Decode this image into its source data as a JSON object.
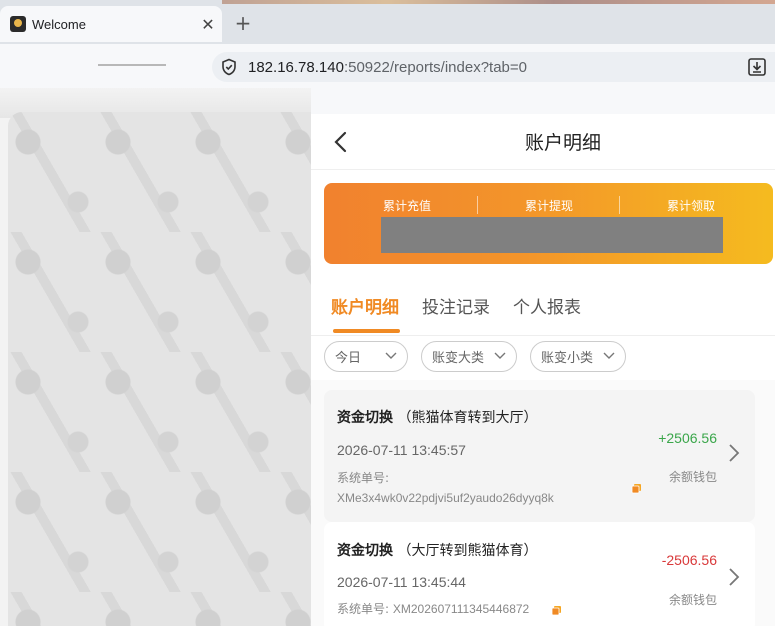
{
  "browser": {
    "tab_title": "Welcome",
    "close_glyph": "✕",
    "newtab_glyph": "+",
    "url_host": "182.16.78.140",
    "url_rest": ":50922/reports/index?tab=0"
  },
  "header": {
    "title": "账户明细"
  },
  "summary": {
    "recharge_label": "累计充值",
    "withdraw_label": "累计提现",
    "claim_label": "累计领取"
  },
  "tabs": [
    {
      "label": "账户明细",
      "active": true
    },
    {
      "label": "投注记录",
      "active": false
    },
    {
      "label": "个人报表",
      "active": false
    }
  ],
  "filters": [
    {
      "label": "今日"
    },
    {
      "label": "账变大类"
    },
    {
      "label": "账变小类"
    }
  ],
  "records": [
    {
      "type": "资金切换",
      "detail": "（熊猫体育转到大厅）",
      "time": "2026-07-11 13:45:57",
      "order_label": "系统单号:",
      "order_no": "XMe3x4wk0v22pdjvi5uf2yaudo26dyyq8k",
      "amount": "+2506.56",
      "wallet": "余额钱包"
    },
    {
      "type": "资金切换",
      "detail": "（大厅转到熊猫体育）",
      "time": "2026-07-11 13:45:44",
      "order_label": "系统单号:",
      "order_no": "XM202607111345446872",
      "amount": "-2506.56",
      "wallet": "余额钱包"
    }
  ],
  "colors": {
    "accent": "#f08a24",
    "positive": "#3aa64a",
    "negative": "#d9393a"
  }
}
